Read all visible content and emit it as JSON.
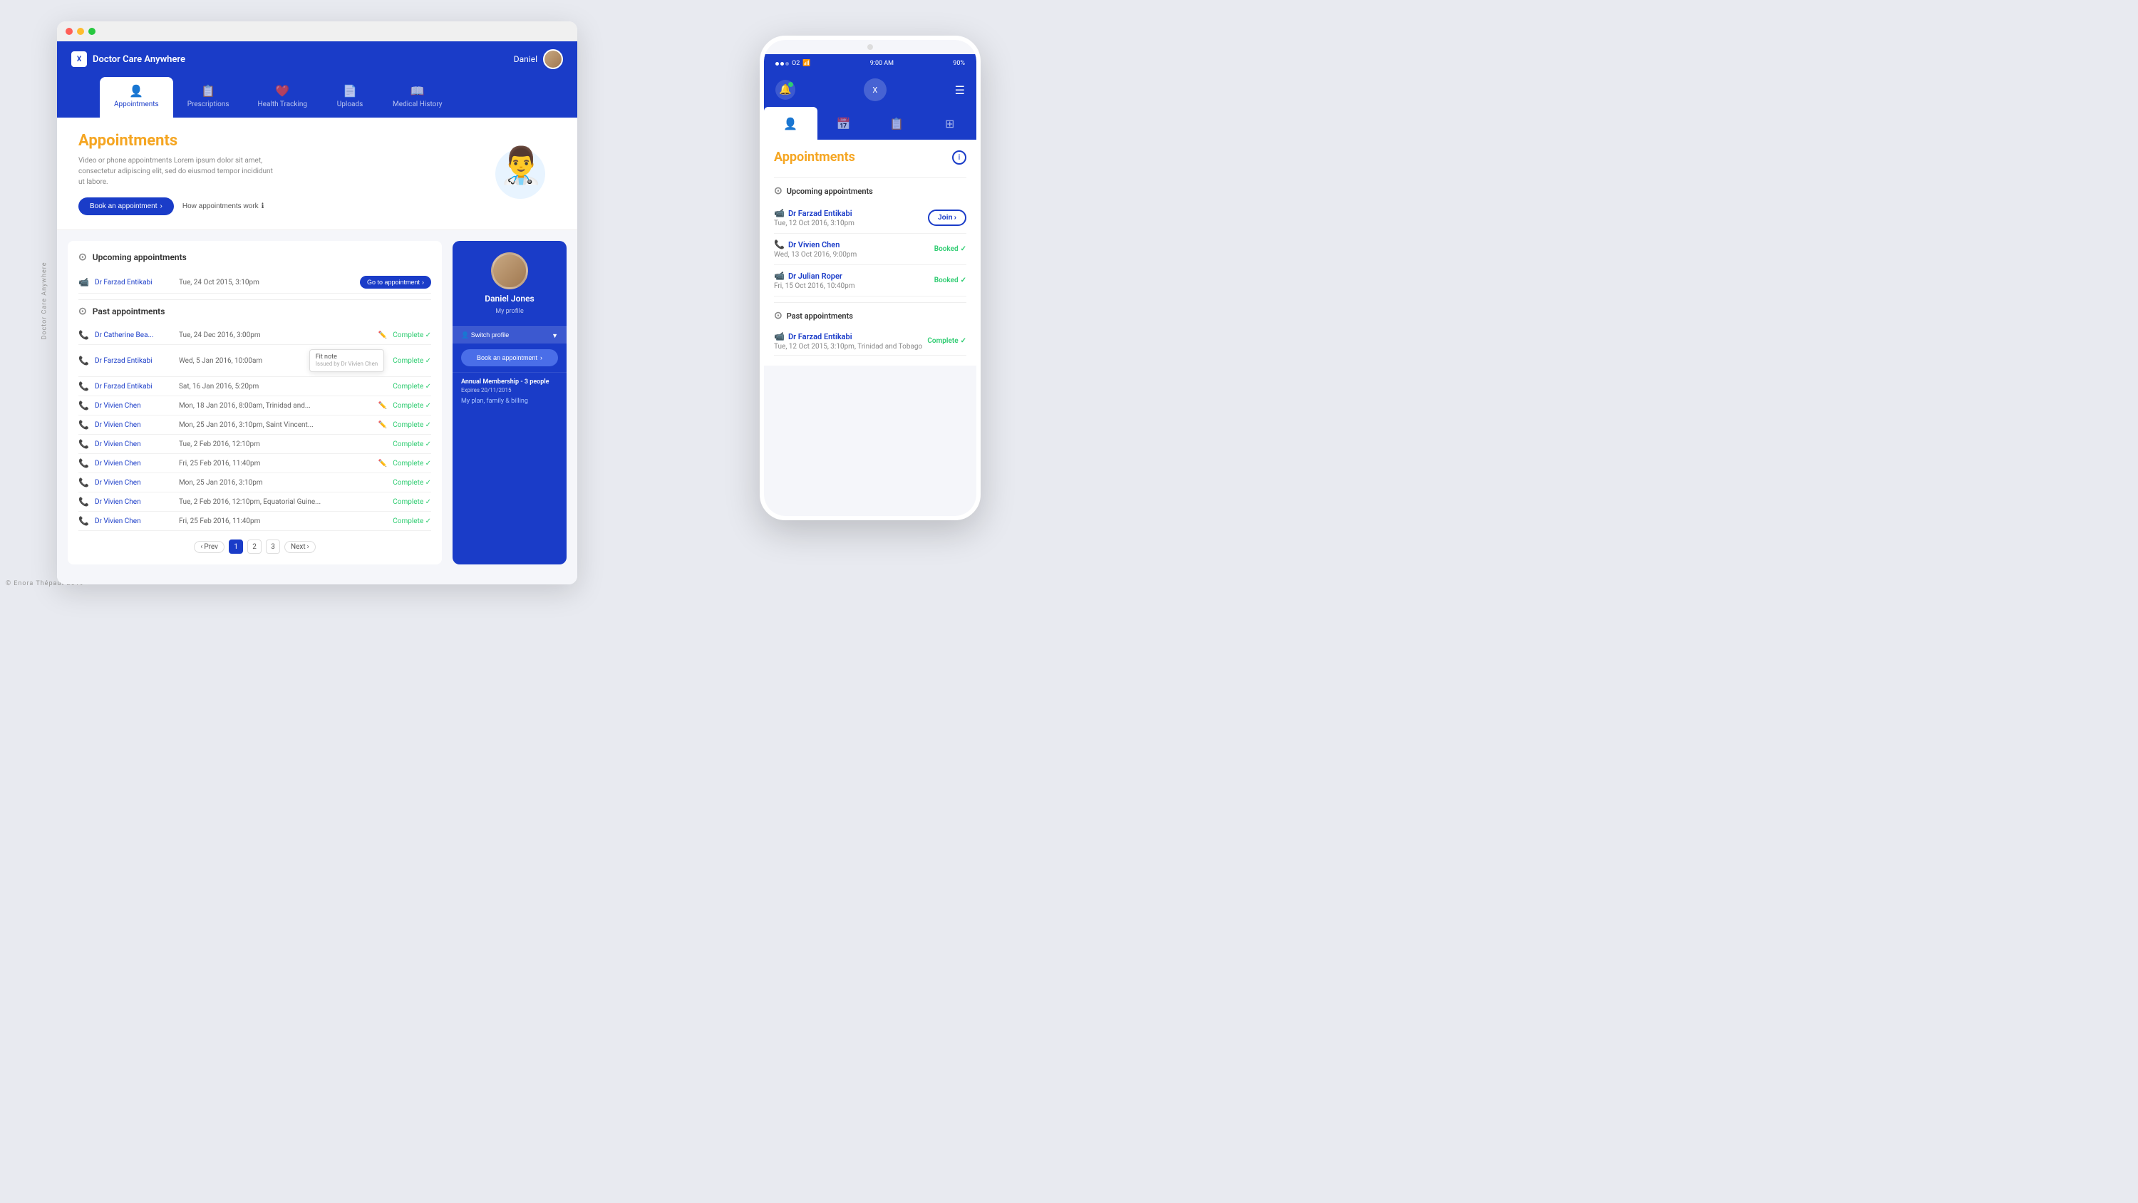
{
  "app": {
    "title": "Doctor Care Anywhere",
    "logo_letter": "X",
    "user_name": "Daniel",
    "side_label_top": "Doctor Care Anywhere",
    "side_label_bottom": "© Enora Thépaut 2019"
  },
  "nav": {
    "tabs": [
      {
        "id": "appointments",
        "label": "Appointments",
        "icon": "👤",
        "active": true
      },
      {
        "id": "prescriptions",
        "label": "Prescriptions",
        "icon": "📋",
        "active": false
      },
      {
        "id": "health-tracking",
        "label": "Health Tracking",
        "icon": "❤️",
        "active": false
      },
      {
        "id": "uploads",
        "label": "Uploads",
        "icon": "📄",
        "active": false
      },
      {
        "id": "medical-history",
        "label": "Medical History",
        "icon": "📖",
        "active": false
      }
    ]
  },
  "hero": {
    "title": "Appointments",
    "description": "Video or phone appointments Lorem ipsum dolor sit amet, consectetur adipiscing elit, sed do eiusmod tempor incididunt ut labore.",
    "book_btn": "Book an appointment",
    "how_btn": "How appointments work"
  },
  "upcoming_section": {
    "title": "Upcoming appointments",
    "appointments": [
      {
        "doctor": "Dr Farzad Entikabi",
        "date": "Tue, 24 Oct 2015, 3:10pm",
        "type": "video",
        "action": "Go to appointment"
      }
    ]
  },
  "past_section": {
    "title": "Past appointments",
    "appointments": [
      {
        "doctor": "Dr Catherine Bea...",
        "date": "Tue, 24 Dec 2016, 3:00pm",
        "status": "Complete",
        "edit": true
      },
      {
        "doctor": "Dr Farzad Entikabi",
        "date": "Wed, 5 Jan 2016, 10:00am",
        "status": "Complete",
        "edit": false,
        "tooltip": true
      },
      {
        "doctor": "Dr Farzad Entikabi",
        "date": "Sat, 16 Jan 2016, 5:20pm",
        "status": "Complete",
        "edit": false
      },
      {
        "doctor": "Dr Vivien Chen",
        "date": "Mon, 18 Jan 2016, 8:00am, Trinidad and...",
        "status": "Complete",
        "edit": true
      },
      {
        "doctor": "Dr Vivien Chen",
        "date": "Mon, 25 Jan 2016, 3:10pm, Saint Vincent...",
        "status": "Complete",
        "edit": true
      },
      {
        "doctor": "Dr Vivien Chen",
        "date": "Tue, 2 Feb 2016, 12:10pm",
        "status": "Complete",
        "edit": false
      },
      {
        "doctor": "Dr Vivien Chen",
        "date": "Fri, 25 Feb 2016, 11:40pm",
        "status": "Complete",
        "edit": true
      },
      {
        "doctor": "Dr Vivien Chen",
        "date": "Mon, 25 Jan 2016, 3:10pm",
        "status": "Complete",
        "edit": false
      },
      {
        "doctor": "Dr Vivien Chen",
        "date": "Tue, 2 Feb 2016, 12:10pm, Equatorial Guine...",
        "status": "Complete",
        "edit": false
      },
      {
        "doctor": "Dr Vivien Chen",
        "date": "Fri, 25 Feb 2016, 11:40pm",
        "status": "Complete",
        "edit": false
      }
    ]
  },
  "tooltip": {
    "title": "Fit note",
    "subtitle": "Issued by Dr Vivien Chen"
  },
  "pagination": {
    "pages": [
      "1",
      "2",
      "3"
    ],
    "active": "1",
    "prev": "Prev",
    "next": "Next"
  },
  "profile": {
    "name": "Daniel Jones",
    "label": "My profile",
    "switch_btn": "Switch profile",
    "book_btn": "Book an appointment",
    "membership_title": "Annual Membership - 3 people",
    "membership_expires": "Expires 20/11/2015",
    "plan_link": "My plan, family & billing"
  },
  "mobile": {
    "carrier": "O2",
    "time": "9:00 AM",
    "battery": "90%",
    "app_title": "Appointments",
    "upcoming_title": "Upcoming appointments",
    "past_title": "Past appointments",
    "upcoming_appointments": [
      {
        "doctor": "Dr Farzad Entikabi",
        "date": "Tue, 12 Oct 2016, 3:10pm",
        "type": "video",
        "action": "Join",
        "action_arrow": "›"
      },
      {
        "doctor": "Dr Vivien Chen",
        "date": "Wed, 13 Oct 2016, 9:00pm",
        "type": "phone",
        "status": "Booked"
      },
      {
        "doctor": "Dr Julian Roper",
        "date": "Fri, 15 Oct 2016, 10:40pm",
        "type": "video",
        "status": "Booked"
      }
    ],
    "past_appointments": [
      {
        "doctor": "Dr Farzad Entikabi",
        "date": "Tue, 12 Oct 2015, 3:10pm, Trinidad and Tobago",
        "type": "video",
        "status": "Complete",
        "edit": true
      }
    ]
  }
}
